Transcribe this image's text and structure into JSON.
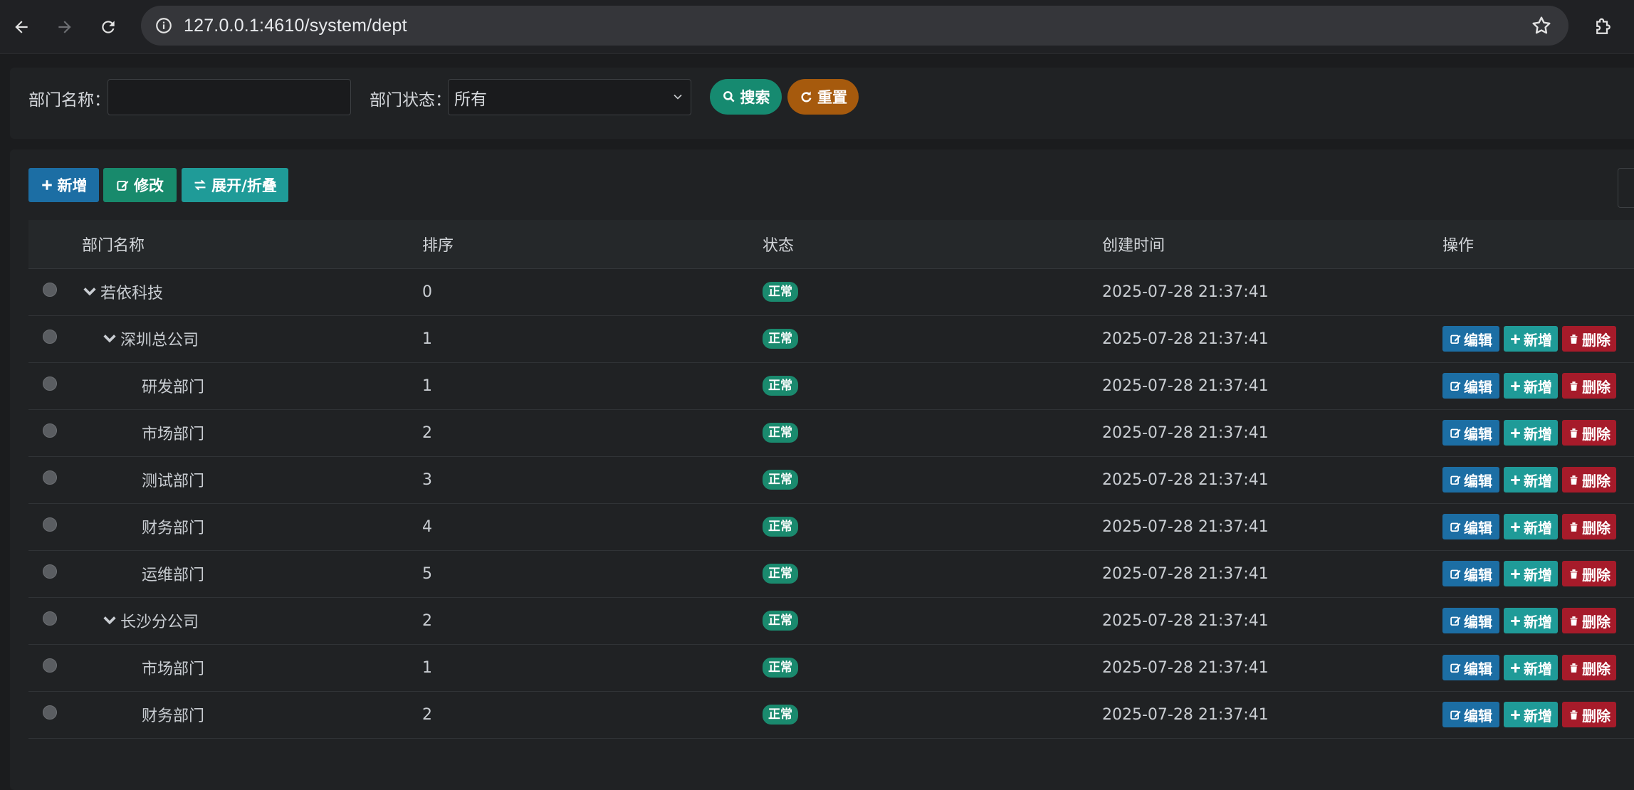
{
  "browser": {
    "url_host": "127.0.0.1:4610",
    "url_path": "/system/dept"
  },
  "search": {
    "dept_name_label": "部门名称：",
    "dept_name_value": "",
    "dept_status_label": "部门状态：",
    "dept_status_selected": "所有",
    "search_button": "搜索",
    "reset_button": "重置"
  },
  "toolbar": {
    "add_button": "新增",
    "edit_button": "修改",
    "toggle_button": "展开/折叠"
  },
  "table": {
    "headers": [
      "部门名称",
      "排序",
      "状态",
      "创建时间",
      "操作"
    ],
    "rows": [
      {
        "name": "若依科技",
        "level": 0,
        "expandable": true,
        "order": "0",
        "status": "正常",
        "created": "2025-07-28 21:37:41",
        "has_ops": false
      },
      {
        "name": "深圳总公司",
        "level": 1,
        "expandable": true,
        "order": "1",
        "status": "正常",
        "created": "2025-07-28 21:37:41",
        "has_ops": true
      },
      {
        "name": "研发部门",
        "level": 2,
        "expandable": false,
        "order": "1",
        "status": "正常",
        "created": "2025-07-28 21:37:41",
        "has_ops": true
      },
      {
        "name": "市场部门",
        "level": 2,
        "expandable": false,
        "order": "2",
        "status": "正常",
        "created": "2025-07-28 21:37:41",
        "has_ops": true
      },
      {
        "name": "测试部门",
        "level": 2,
        "expandable": false,
        "order": "3",
        "status": "正常",
        "created": "2025-07-28 21:37:41",
        "has_ops": true
      },
      {
        "name": "财务部门",
        "level": 2,
        "expandable": false,
        "order": "4",
        "status": "正常",
        "created": "2025-07-28 21:37:41",
        "has_ops": true
      },
      {
        "name": "运维部门",
        "level": 2,
        "expandable": false,
        "order": "5",
        "status": "正常",
        "created": "2025-07-28 21:37:41",
        "has_ops": true
      },
      {
        "name": "长沙分公司",
        "level": 1,
        "expandable": true,
        "order": "2",
        "status": "正常",
        "created": "2025-07-28 21:37:41",
        "has_ops": true
      },
      {
        "name": "市场部门",
        "level": 2,
        "expandable": false,
        "order": "1",
        "status": "正常",
        "created": "2025-07-28 21:37:41",
        "has_ops": true
      },
      {
        "name": "财务部门",
        "level": 2,
        "expandable": false,
        "order": "2",
        "status": "正常",
        "created": "2025-07-28 21:37:41",
        "has_ops": true
      }
    ],
    "row_ops": {
      "edit": "编辑",
      "add": "新增",
      "delete": "删除"
    }
  },
  "colors": {
    "primary": "#1c6ea4",
    "success": "#188a6c",
    "info": "#1f9b98",
    "danger": "#a61b2a",
    "warning": "#a65a0d"
  }
}
